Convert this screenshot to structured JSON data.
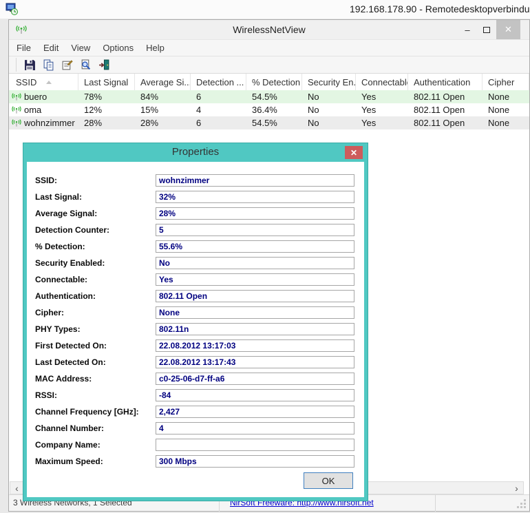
{
  "rdp_bar": {
    "title": "192.168.178.90 - Remotedesktopverbindu"
  },
  "app": {
    "title": "WirelessNetView",
    "menu": [
      "File",
      "Edit",
      "View",
      "Options",
      "Help"
    ],
    "controls": {
      "minimize": "–",
      "close": "✕"
    }
  },
  "table": {
    "columns": [
      "SSID",
      "Last Signal",
      "Average Si...",
      "Detection ...",
      "% Detection",
      "Security En...",
      "Connectable",
      "Authentication",
      "Cipher"
    ],
    "rows": [
      {
        "ssid": "buero",
        "values": [
          "78%",
          "84%",
          "6",
          "54.5%",
          "No",
          "Yes",
          "802.11 Open",
          "None"
        ],
        "bg": "#e3f6e3"
      },
      {
        "ssid": "oma",
        "values": [
          "12%",
          "15%",
          "4",
          "36.4%",
          "No",
          "Yes",
          "802.11 Open",
          "None"
        ],
        "bg": "#ffffff"
      },
      {
        "ssid": "wohnzimmer",
        "values": [
          "28%",
          "28%",
          "6",
          "54.5%",
          "No",
          "Yes",
          "802.11 Open",
          "None"
        ],
        "bg": "#ececec"
      }
    ]
  },
  "dialog": {
    "title": "Properties",
    "accent_color": "#50c8c2",
    "close_color": "#cd5c5c",
    "value_color": "#000080",
    "close_glyph": "✕",
    "fields": [
      {
        "label": "SSID:",
        "value": "wohnzimmer"
      },
      {
        "label": "Last Signal:",
        "value": "32%"
      },
      {
        "label": "Average Signal:",
        "value": "28%"
      },
      {
        "label": "Detection Counter:",
        "value": "5"
      },
      {
        "label": "% Detection:",
        "value": "55.6%"
      },
      {
        "label": "Security Enabled:",
        "value": "No"
      },
      {
        "label": "Connectable:",
        "value": "Yes"
      },
      {
        "label": "Authentication:",
        "value": "802.11 Open"
      },
      {
        "label": "Cipher:",
        "value": "None"
      },
      {
        "label": "PHY Types:",
        "value": "802.11n"
      },
      {
        "label": "First Detected On:",
        "value": "22.08.2012 13:17:03"
      },
      {
        "label": "Last Detected On:",
        "value": "22.08.2012 13:17:43"
      },
      {
        "label": "MAC Address:",
        "value": "c0-25-06-d7-ff-a6"
      },
      {
        "label": "RSSI:",
        "value": "-84"
      },
      {
        "label": "Channel Frequency [GHz]:",
        "value": "2,427"
      },
      {
        "label": "Channel Number:",
        "value": "4"
      },
      {
        "label": "Company Name:",
        "value": ""
      },
      {
        "label": "Maximum Speed:",
        "value": "300 Mbps"
      }
    ],
    "ok_label": "OK"
  },
  "status_bar": {
    "networks": "3 Wireless Networks, 1 Selected",
    "link": "NirSoft Freeware: http://www.nirsoft.net"
  },
  "scrollbar": {
    "left": "‹",
    "right": "›"
  }
}
